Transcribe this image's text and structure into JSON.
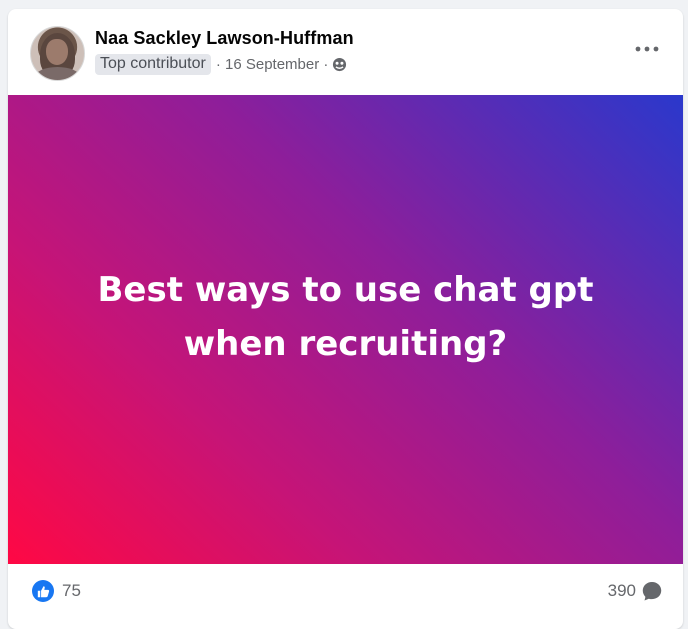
{
  "post": {
    "author": "Naa Sackley Lawson-Huffman",
    "badge": "Top contributor",
    "date": "· 16 September ·",
    "audience_icon": "globe-icon",
    "more_icon": "more-horizontal-icon",
    "banner_text": "Best ways to use chat gpt when recruiting?",
    "like_count": "75",
    "comment_count": "390"
  },
  "colors": {
    "banner_gradient_start": "#ff0844",
    "banner_gradient_end": "#2a38cc",
    "like_blue": "#1877f2",
    "meta_gray": "#65676b"
  }
}
